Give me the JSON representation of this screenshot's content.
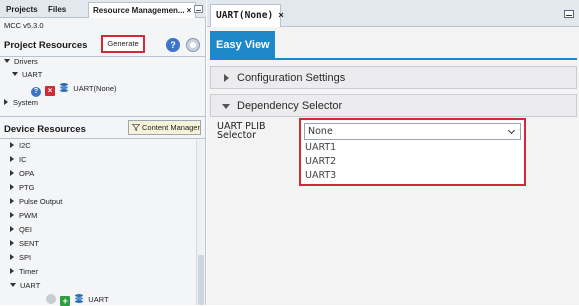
{
  "left_panel": {
    "tabs": [
      {
        "label": "Projects"
      },
      {
        "label": "Files"
      },
      {
        "label": "Resource Managemen..."
      }
    ],
    "active_tab_close": "×",
    "mcc_version": "MCC v5.3.0",
    "project_resources": {
      "title": "Project Resources",
      "generate_label": "Generate",
      "help_glyph": "?",
      "tree": [
        {
          "label": "Drivers"
        },
        {
          "label": "UART"
        },
        {
          "label": "UART(None)"
        },
        {
          "label": "System"
        }
      ]
    },
    "device_resources": {
      "title": "Device Resources",
      "content_manager_label": "Content Manager",
      "items": [
        "I2C",
        "IC",
        "OPA",
        "PTG",
        "Pulse Output",
        "PWM",
        "QEI",
        "SENT",
        "SPI",
        "Timer",
        "UART"
      ],
      "uart_child": "UART"
    }
  },
  "right_panel": {
    "tab_label": "UART(None)",
    "tab_close": "×",
    "easy_view_label": "Easy View",
    "sections": [
      {
        "title": "Configuration Settings",
        "expanded": false
      },
      {
        "title": "Dependency Selector",
        "expanded": true
      }
    ],
    "plib_selector": {
      "label_line1": "UART PLIB",
      "label_line2": "Selector",
      "selected": "None",
      "options": [
        "UART1",
        "UART2",
        "UART3"
      ]
    }
  },
  "colors": {
    "accent_blue": "#1c87c9",
    "highlight_red": "#d12a36"
  },
  "icons": [
    "help-icon",
    "remove-icon",
    "add-icon",
    "library-stack-icon",
    "settings-icon",
    "filter-icon",
    "minimize-icon",
    "chevron-down-icon"
  ]
}
